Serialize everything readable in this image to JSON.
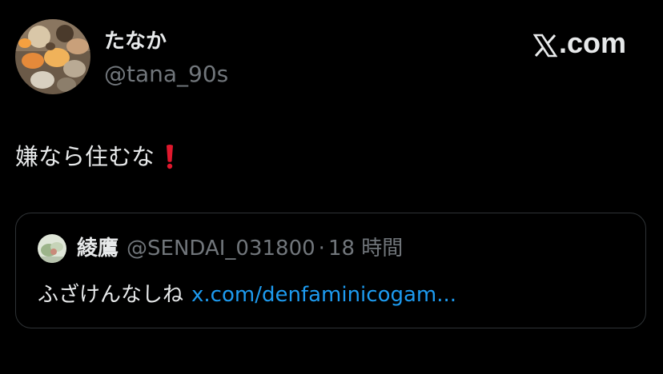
{
  "author": {
    "display_name": "たなか",
    "handle": "@tana_90s",
    "avatar": "food-photo-avatar"
  },
  "brand": {
    "label": ".com",
    "logo": "x-logo-icon"
  },
  "tweet": {
    "text": "嫌なら住むな",
    "emoji": "red-exclamation-icon"
  },
  "quoted": {
    "display_name": "綾鷹",
    "handle": "@SENDAI_031800",
    "separator": "·",
    "time": "18 時間",
    "text": "ふざけんなしね",
    "link": "x.com/denfaminicogam...",
    "avatar": "small-avatar"
  },
  "colors": {
    "background": "#000000",
    "text": "#e7e9ea",
    "secondary": "#71767b",
    "link": "#1d9bf0",
    "border": "#2f3336",
    "emoji_red": "#e0182d"
  }
}
